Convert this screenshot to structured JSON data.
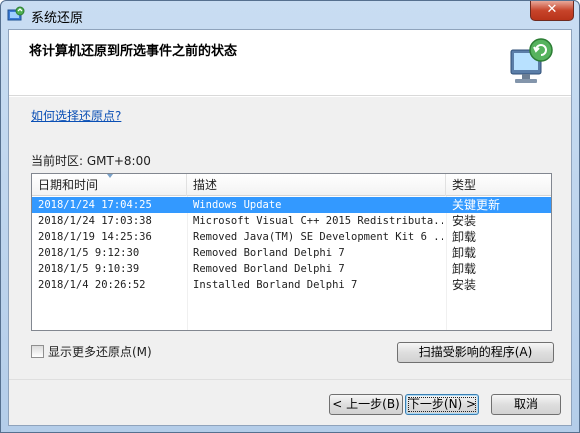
{
  "window": {
    "title": "系统还原",
    "close_label": "✕",
    "title_icon": "system-restore-icon"
  },
  "header": {
    "title": "将计算机还原到所选事件之前的状态",
    "icon": "restore-monitor-icon"
  },
  "help_link": "如何选择还原点?",
  "timezone": "当前时区: GMT+8:00",
  "table": {
    "columns": [
      "日期和时间",
      "描述",
      "类型"
    ],
    "rows": [
      {
        "date": "2018/1/24 17:04:25",
        "desc": "Windows Update",
        "type": "关键更新",
        "selected": true
      },
      {
        "date": "2018/1/24 17:03:38",
        "desc": "Microsoft Visual C++ 2015 Redistributa...",
        "type": "安装"
      },
      {
        "date": "2018/1/19 14:25:36",
        "desc": "Removed Java(TM) SE Development Kit 6 ...",
        "type": "卸载"
      },
      {
        "date": "2018/1/5 9:12:30",
        "desc": "Removed Borland Delphi 7",
        "type": "卸载"
      },
      {
        "date": "2018/1/5 9:10:39",
        "desc": "Removed Borland Delphi 7",
        "type": "卸载"
      },
      {
        "date": "2018/1/4 20:26:52",
        "desc": "Installed Borland Delphi 7",
        "type": "安装"
      }
    ]
  },
  "show_more": {
    "label": "显示更多还原点(M)",
    "checked": false
  },
  "buttons": {
    "scan": "扫描受影响的程序(A)",
    "back": "< 上一步(B)",
    "next": "下一步(N) >",
    "cancel": "取消"
  },
  "colors": {
    "selection": "#3399ff",
    "link": "#0a4fb5",
    "close": "#c7442a"
  }
}
